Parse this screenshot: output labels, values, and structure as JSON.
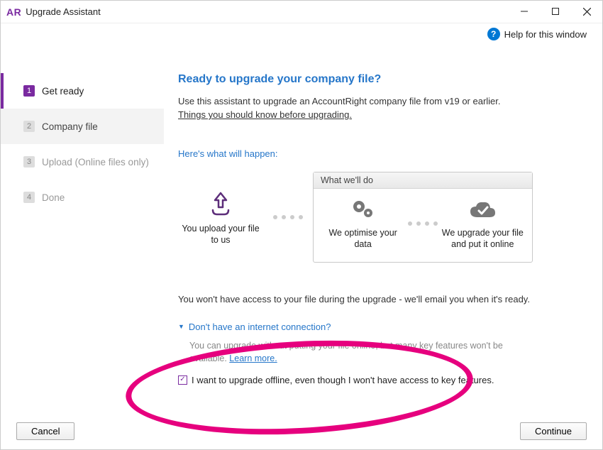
{
  "window": {
    "logo": "AR",
    "title": "Upgrade Assistant"
  },
  "help_link": "Help for this window",
  "steps": [
    {
      "num": "1",
      "label": "Get ready"
    },
    {
      "num": "2",
      "label": "Company file"
    },
    {
      "num": "3",
      "label": "Upload (Online files only)"
    },
    {
      "num": "4",
      "label": "Done"
    }
  ],
  "main": {
    "heading": "Ready to upgrade your company file?",
    "intro": "Use this assistant to upgrade an AccountRight company file from v19 or earlier.",
    "things_link": "Things you should know before upgrading.",
    "subheading": "Here's what will happen:",
    "flow": {
      "step1": "You upload your file to us",
      "box_header": "What we'll do",
      "step2": "We optimise your data",
      "step3": "We upgrade your file and put it online"
    },
    "note": "You won't have access to your file during the upgrade - we'll email you when it's ready.",
    "expander": {
      "title": "Don't have an internet connection?",
      "body_a": "You can upgrade without putting your file online, but many key features won't be available. ",
      "learn_more": "Learn more.",
      "checkbox_label": "I want to upgrade offline, even though I won't have access to key features."
    }
  },
  "buttons": {
    "cancel": "Cancel",
    "continue": "Continue"
  }
}
